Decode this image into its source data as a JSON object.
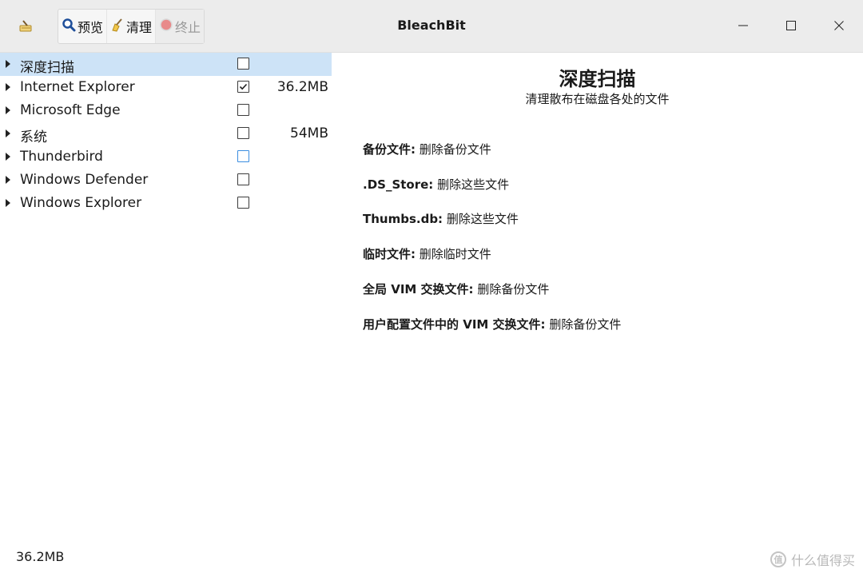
{
  "window": {
    "title": "BleachBit"
  },
  "toolbar": {
    "preview_label": "预览",
    "clean_label": "清理",
    "stop_label": "终止"
  },
  "icons": {
    "app": "broom-icon",
    "preview": "magnifier-icon",
    "clean": "broom-icon",
    "stop": "stop-circle-icon",
    "minimize": "minimize-icon",
    "maximize": "maximize-icon",
    "close": "close-icon"
  },
  "tree": {
    "items": [
      {
        "label": "深度扫描",
        "checked": false,
        "size": "",
        "selected": true
      },
      {
        "label": "Internet Explorer",
        "checked": true,
        "size": "36.2MB",
        "selected": false
      },
      {
        "label": "Microsoft Edge",
        "checked": false,
        "size": "",
        "selected": false
      },
      {
        "label": "系统",
        "checked": false,
        "size": "54MB",
        "selected": false
      },
      {
        "label": "Thunderbird",
        "checked": false,
        "size": "",
        "selected": false
      },
      {
        "label": "Windows Defender",
        "checked": false,
        "size": "",
        "selected": false
      },
      {
        "label": "Windows Explorer",
        "checked": false,
        "size": "",
        "selected": false
      }
    ]
  },
  "description": {
    "title": "深度扫描",
    "subtitle": "清理散布在磁盘各处的文件",
    "options": [
      {
        "name": "备份文件:",
        "text": "删除备份文件"
      },
      {
        "name": ".DS_Store:",
        "text": "删除这些文件"
      },
      {
        "name": "Thumbs.db:",
        "text": "删除这些文件"
      },
      {
        "name": "临时文件:",
        "text": "删除临时文件"
      },
      {
        "name": "全局 VIM 交换文件:",
        "text": "删除备份文件"
      },
      {
        "name": "用户配置文件中的 VIM 交换文件:",
        "text": "删除备份文件"
      }
    ]
  },
  "status": {
    "text": "36.2MB"
  },
  "watermark": {
    "logo": "值",
    "text": "什么值得买"
  },
  "colors": {
    "selection": "#cde3f7",
    "titlebar": "#ececec",
    "focus": "#3b8de0"
  }
}
